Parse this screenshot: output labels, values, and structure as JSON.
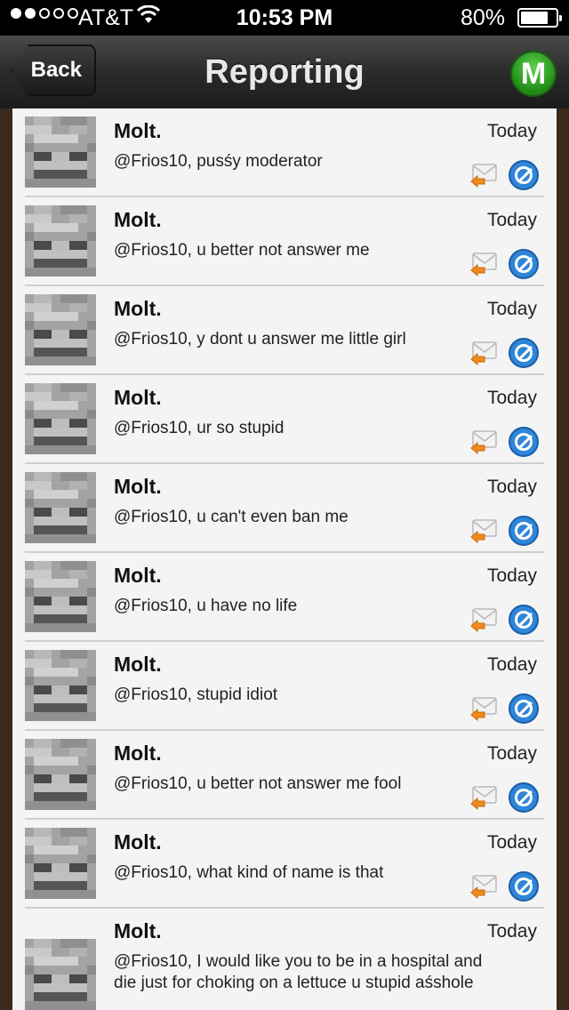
{
  "status_bar": {
    "carrier": "AT&T",
    "time": "10:53 PM",
    "battery": "80%",
    "battery_level": 0.8
  },
  "nav": {
    "back_label": "Back",
    "title": "Reporting",
    "m_button_label": "M"
  },
  "icons": {
    "reply": "reply-envelope-icon",
    "block": "block-icon"
  },
  "messages": [
    {
      "author": "Molt.",
      "time": "Today",
      "text": "@Frios10, pusśy moderator"
    },
    {
      "author": "Molt.",
      "time": "Today",
      "text": "@Frios10, u better not answer me"
    },
    {
      "author": "Molt.",
      "time": "Today",
      "text": "@Frios10, y dont u answer me little girl"
    },
    {
      "author": "Molt.",
      "time": "Today",
      "text": "@Frios10, ur so stupid"
    },
    {
      "author": "Molt.",
      "time": "Today",
      "text": "@Frios10, u can't even ban me"
    },
    {
      "author": "Molt.",
      "time": "Today",
      "text": "@Frios10, u have no life"
    },
    {
      "author": "Molt.",
      "time": "Today",
      "text": "@Frios10, stupid idiot"
    },
    {
      "author": "Molt.",
      "time": "Today",
      "text": "@Frios10, u better not answer me fool"
    },
    {
      "author": "Molt.",
      "time": "Today",
      "text": "@Frios10, what kind of name is that"
    },
    {
      "author": "Molt.",
      "time": "Today",
      "text": "@Frios10, I would like you to be in a hospital and die just for choking on a lettuce u stupid aśshole"
    }
  ]
}
